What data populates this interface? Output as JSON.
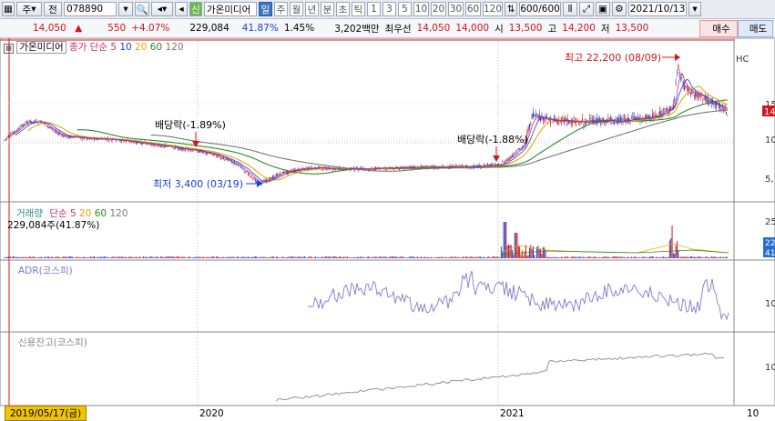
{
  "toolbar": {
    "market_label": "주",
    "nav_label": "전",
    "code": "078890",
    "badge": "신",
    "stock_name": "가온미디어",
    "period_daily": "일",
    "period_weekly": "주",
    "period_monthly": "월",
    "period_yearly": "년",
    "period_minute": "분",
    "period_second": "초",
    "period_tick": "틱",
    "intervals": [
      "1",
      "3",
      "5",
      "10",
      "20",
      "30",
      "60",
      "120"
    ],
    "count": "600/600",
    "date": "2021/10/13"
  },
  "info": {
    "price": "14,050",
    "change": "550",
    "change_pct": "+4.07%",
    "volume": "229,084",
    "volume_ratio": "41.87%",
    "turnover": "1.45%",
    "amount": "3,202백만",
    "best_ask_label": "최우선",
    "best_ask": "14,050",
    "best_bid": "14,000",
    "open_label": "시",
    "open": "13,500",
    "high_label": "고",
    "high": "14,200",
    "low_label": "저",
    "low": "13,500",
    "buy_label": "매수",
    "sell_label": "매도"
  },
  "price_panel": {
    "title": "가온미디어",
    "ma_label": "종가 단순",
    "ma_periods": [
      "5",
      "10",
      "20",
      "60",
      "120"
    ],
    "ma_colors": [
      "#c0306f",
      "#1a3fd1",
      "#e6a800",
      "#2a8a2a",
      "#777777"
    ],
    "annotation_high": "최고 22,200 (08/09)",
    "annotation_low": "최저 3,400 (03/19)",
    "annotation_div1": "배당락(-1.89%)",
    "annotation_div2": "배당락(-1.88%)",
    "right_axis": [
      "HC",
      "15",
      "14",
      "10",
      "5,"
    ]
  },
  "volume_panel": {
    "title": "거래량",
    "ma_label": "단순",
    "ma_periods": [
      "5",
      "20",
      "60",
      "120"
    ],
    "current": "229,084주(41.87%)",
    "right_axis": [
      "25",
      "22",
      "41"
    ]
  },
  "adr_panel": {
    "title": "ADR(코스피)",
    "right_axis": [
      "10"
    ]
  },
  "credit_panel": {
    "title": "신용잔고(코스피)",
    "right_axis": [
      "10"
    ]
  },
  "x_axis": {
    "start_date": "2019/05/17(금)",
    "labels": [
      "2020",
      "2021",
      "10"
    ]
  },
  "colors": {
    "up": "#d4141b",
    "down": "#1a3fd1",
    "adr_line": "#7b7bd0",
    "credit_line": "#888888"
  }
}
